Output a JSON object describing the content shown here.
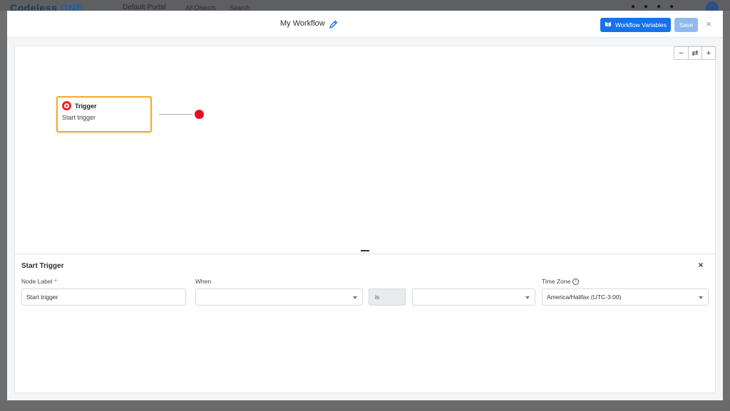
{
  "background": {
    "logo_text": "Codeless",
    "logo_accent": "ONE",
    "portal": "Default Portal",
    "all_objects": "All Objects",
    "search": "Search"
  },
  "header": {
    "title": "My Workflow",
    "edit_icon": "pencil-icon",
    "workflow_variables_label": "Workflow Variables",
    "save_label": "Save",
    "close_symbol": "×"
  },
  "canvas": {
    "zoom_out_symbol": "−",
    "reset_symbol": "⇄",
    "zoom_in_symbol": "+",
    "node": {
      "title": "Trigger",
      "subtitle": "Start trigger"
    }
  },
  "panel": {
    "title": "Start Trigger",
    "close_symbol": "×",
    "node_label_label": "Node Label",
    "required_mark": "*",
    "node_label_value": "Start trigger",
    "when_label": "When",
    "when_value": "",
    "is_text": "is",
    "condition_value": "",
    "time_zone_label": "Time Zone",
    "info_symbol": "i",
    "time_zone_value": "America/Halifax (UTC-3:00)"
  },
  "colors": {
    "primary": "#1673e6",
    "primary_disabled": "#8fbaf0",
    "node_border": "#f4a92b",
    "trigger_red": "#e80f1e"
  }
}
